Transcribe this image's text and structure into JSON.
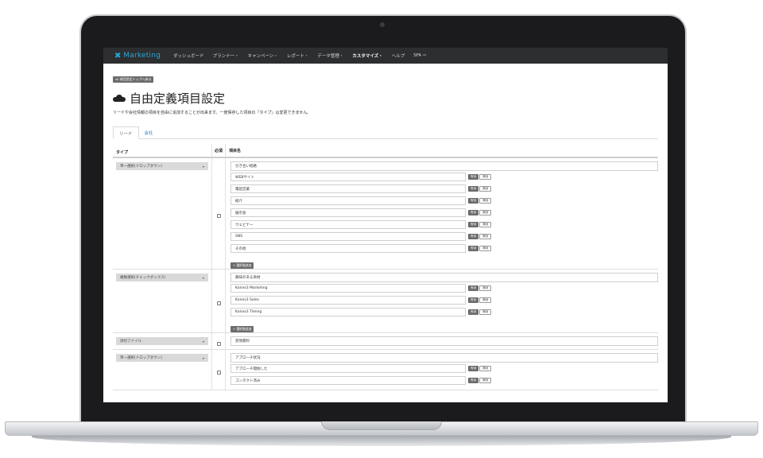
{
  "nav": {
    "logo": "Marketing",
    "items": [
      "ダッシュボード",
      "プランナー・",
      "キャンペーン・",
      "レポート・",
      "データ管理・",
      "カスタマイズ・",
      "ヘルプ",
      "SFA ⇨"
    ],
    "active_index": 5
  },
  "page": {
    "back_label": "≪ 項目設定トップへ戻る",
    "title": "自由定義項目設定",
    "description": "リードや会社情報の項目を自由に追加することが出来ます。一度保存した項目の「タイプ」は変更できません。"
  },
  "tabs": [
    {
      "label": "リード",
      "active": true
    },
    {
      "label": "会社",
      "active": false
    }
  ],
  "table": {
    "headers": {
      "type": "タイプ",
      "required": "必須",
      "name": "項目名"
    },
    "enable_label": "有効",
    "disable_label": "無効",
    "add_option_label": "+ 選択肢追加",
    "rows": [
      {
        "type": "単一選択(ドロップダウン)",
        "title": "引き合い経路",
        "options": [
          "WEBサイト",
          "電話営業",
          "紹介",
          "展示会",
          "ウェビナー",
          "SNS",
          "その他"
        ],
        "has_add": true
      },
      {
        "type": "複数選択(チェックボックス)",
        "title": "興味のある商材",
        "options": [
          "Kairos3 Marketing",
          "Kairos3 Sales",
          "Kairos3 Timing"
        ],
        "has_add": true
      },
      {
        "type": "添付ファイル",
        "title": "受領資料",
        "options": [],
        "has_add": false
      },
      {
        "type": "単一選択(ドロップダウン)",
        "title": "アプローチ状況",
        "options": [
          "アプローチ開始した",
          "コンタクト済み"
        ],
        "has_add": false
      }
    ]
  },
  "colors": {
    "navbar": "#2d2e30",
    "brand": "#2aa7d6",
    "button": "#6c6c6c",
    "link": "#2a7fc2"
  }
}
